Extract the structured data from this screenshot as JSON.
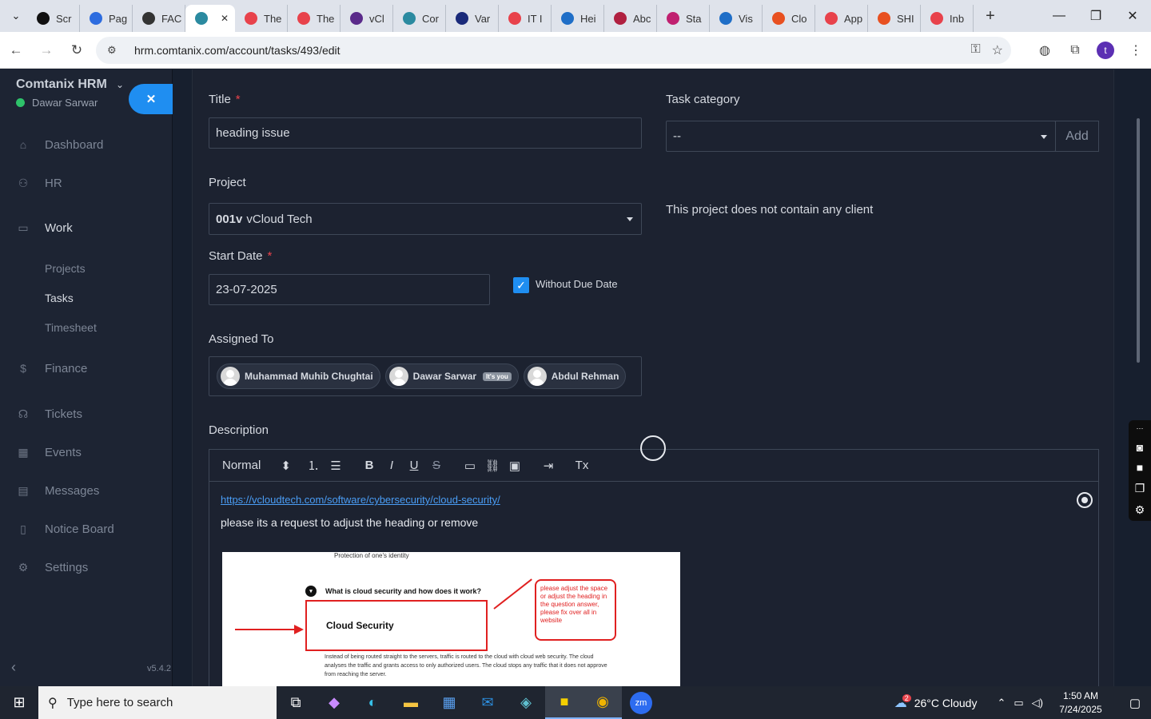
{
  "browser": {
    "tabs": [
      {
        "label": "Scr",
        "color": "#111111"
      },
      {
        "label": "Pag",
        "color": "#2d6cdf"
      },
      {
        "label": "FAC",
        "color": "#333333"
      },
      {
        "label": "",
        "color": "#2b8aa0",
        "active": true
      },
      {
        "label": "The",
        "color": "#e8424b"
      },
      {
        "label": "The",
        "color": "#e8424b"
      },
      {
        "label": "vCl",
        "color": "#5a2a8a"
      },
      {
        "label": "Cor",
        "color": "#2b8aa0"
      },
      {
        "label": "Var",
        "color": "#1a2a7a"
      },
      {
        "label": "IT I",
        "color": "#e8424b"
      },
      {
        "label": "Hei",
        "color": "#1f6ec7"
      },
      {
        "label": "Abc",
        "color": "#b02040"
      },
      {
        "label": "Sta",
        "color": "#c02070"
      },
      {
        "label": "Vis",
        "color": "#1f6ec7"
      },
      {
        "label": "Clo",
        "color": "#e85020"
      },
      {
        "label": "App",
        "color": "#e8424b"
      },
      {
        "label": "SHI",
        "color": "#e85020"
      },
      {
        "label": "Inb",
        "color": "#e8424b"
      }
    ],
    "url": "hrm.comtanix.com/account/tasks/493/edit",
    "profile_initial": "t"
  },
  "sidebar": {
    "brand": "Comtanix HRM",
    "user": "Dawar Sarwar",
    "menu": {
      "dashboard": "Dashboard",
      "hr": "HR",
      "work": "Work",
      "projects": "Projects",
      "tasks": "Tasks",
      "timesheet": "Timesheet",
      "finance": "Finance",
      "tickets": "Tickets",
      "events": "Events",
      "messages": "Messages",
      "notice_board": "Notice Board",
      "settings": "Settings"
    },
    "version": "v5.4.2"
  },
  "form": {
    "title_label": "Title",
    "title_value": "heading issue",
    "category_label": "Task category",
    "category_value": "--",
    "category_add": "Add",
    "project_label": "Project",
    "project_code": "001v",
    "project_name": "vCloud Tech",
    "project_note": "This project does not contain any client",
    "start_label": "Start Date",
    "start_value": "23-07-2025",
    "without_due": "Without Due Date",
    "assigned_label": "Assigned To",
    "assignees": [
      "Muhammad Muhib Chughtai",
      "Dawar Sarwar",
      "Abdul Rehman"
    ],
    "you_badge": "It's you",
    "description_label": "Description",
    "editor_format": "Normal",
    "desc_link": "https://vcloudtech.com/software/cybersecurity/cloud-security/",
    "desc_text": "please its a request to adjust the heading or remove"
  },
  "screenshot": {
    "bullet": "Protection of one's identity",
    "question": "What is cloud security and how does it work?",
    "box_title": "Cloud Security",
    "callout": "please adjust the space or adjust the heading in the question answer, please fix over all in website",
    "paragraph": "Instead of being routed straight to the servers, traffic is routed to the cloud with cloud web security. The cloud analyses the traffic and grants access to only authorized users. The cloud stops any traffic that it does not approve from reaching the server."
  },
  "taskbar": {
    "search_placeholder": "Type here to search",
    "weather": "26°C  Cloudy",
    "weather_badge": "2",
    "time": "1:50 AM",
    "date": "7/24/2025"
  }
}
